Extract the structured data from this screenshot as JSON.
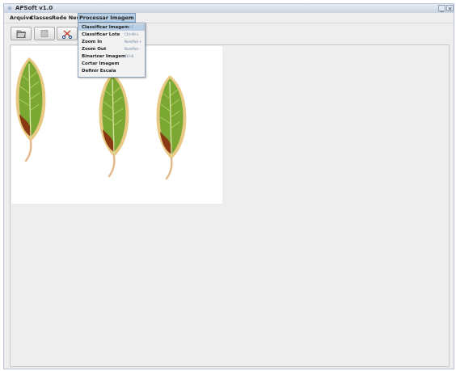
{
  "window": {
    "title": "APSoft v1.0",
    "minimize": "_",
    "close": "×"
  },
  "menubar": {
    "items": [
      "Arquivo",
      "Classes",
      "Rede Neural",
      "Processar Imagem"
    ]
  },
  "toolbar": {
    "buttons": [
      {
        "icon": "folder-open-icon"
      },
      {
        "icon": "stop-icon"
      },
      {
        "icon": "scissors-icon"
      }
    ]
  },
  "menu_processar": {
    "items": [
      {
        "label": "Classificar Imagem",
        "accel": "Ctrl-C"
      },
      {
        "label": "Classificar Lote",
        "accel": "Ctrl-Alt-L"
      },
      {
        "label": "Zoom In",
        "accel": "NumPad +"
      },
      {
        "label": "Zoom Out",
        "accel": "NumPad -"
      },
      {
        "label": "Binarizar Imagem",
        "accel": "Ctrl-B"
      },
      {
        "label": "Cortar Imagem",
        "accel": ""
      },
      {
        "label": "Definir Escala",
        "accel": ""
      }
    ]
  },
  "colors": {
    "leaf_green": "#7aa833",
    "leaf_dark": "#3d6a1c",
    "leaf_brown": "#8a3a12",
    "leaf_rim": "#e7c983",
    "menu_selected": "#b8cfe5"
  }
}
